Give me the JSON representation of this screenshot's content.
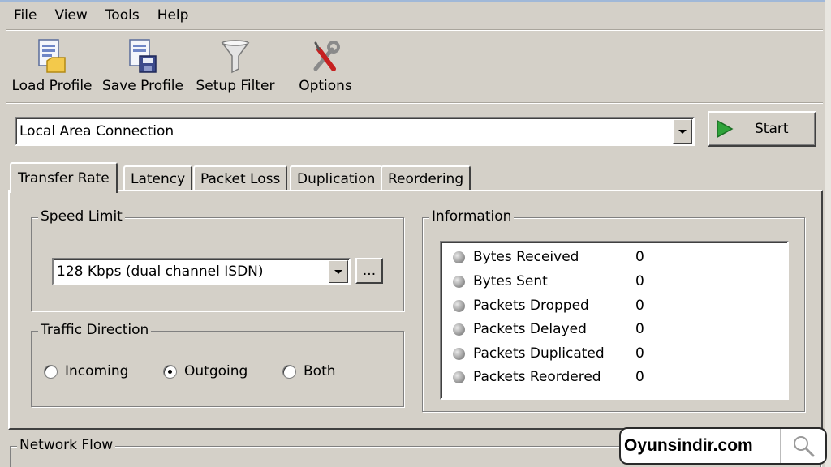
{
  "menu": [
    "File",
    "View",
    "Tools",
    "Help"
  ],
  "toolbar": {
    "load_profile": "Load Profile",
    "save_profile": "Save Profile",
    "setup_filter": "Setup Filter",
    "options": "Options"
  },
  "adapter": {
    "selected": "Local Area Connection"
  },
  "start_label": "Start",
  "tabs": [
    "Transfer Rate",
    "Latency",
    "Packet Loss",
    "Duplication",
    "Reordering"
  ],
  "speed_limit": {
    "title": "Speed Limit",
    "selected": "128 Kbps (dual channel ISDN)",
    "more_label": "..."
  },
  "traffic_direction": {
    "title": "Traffic Direction",
    "options": [
      "Incoming",
      "Outgoing",
      "Both"
    ],
    "selected": "Outgoing"
  },
  "information": {
    "title": "Information",
    "rows": [
      {
        "label": "Bytes Received",
        "value": "0"
      },
      {
        "label": "Bytes Sent",
        "value": "0"
      },
      {
        "label": "Packets Dropped",
        "value": "0"
      },
      {
        "label": "Packets Delayed",
        "value": "0"
      },
      {
        "label": "Packets Duplicated",
        "value": "0"
      },
      {
        "label": "Packets Reordered",
        "value": "0"
      }
    ]
  },
  "network_flow": {
    "title": "Network Flow"
  },
  "watermark": "Oyunsindir.com",
  "colors": {
    "window_bg": "#d4d0c8",
    "start_icon": "#2fa33a"
  }
}
